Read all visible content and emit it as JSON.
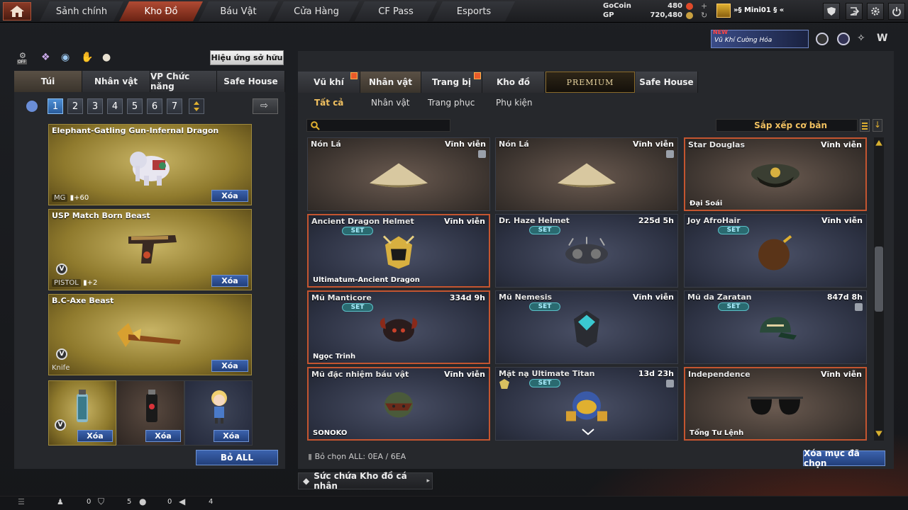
{
  "nav": {
    "tabs": [
      "Sảnh chính",
      "Kho Đồ",
      "Báu Vật",
      "Cửa Hàng",
      "CF Pass",
      "Esports"
    ],
    "active": 1
  },
  "currency": {
    "gocoin_label": "GoCoin",
    "gocoin_value": "480",
    "gp_label": "GP",
    "gp_value": "720,480"
  },
  "user": {
    "name": "»§ Mini01 § «"
  },
  "banner": {
    "new": "NEW",
    "text": "Vũ Khí Cường Hóa"
  },
  "left": {
    "effects_button": "Hiệu ứng sở hữu",
    "off_label": "OFF",
    "tabs": [
      "Túi",
      "Nhân vật",
      "VP Chức năng",
      "Safe House"
    ],
    "pages": [
      "1",
      "2",
      "3",
      "4",
      "5",
      "6",
      "7"
    ],
    "items": [
      {
        "name": "Elephant-Gatling Gun-Infernal Dragon",
        "tag": "MG",
        "bonus": "+60",
        "delete": "Xóa"
      },
      {
        "name": "USP Match Born Beast",
        "tag": "PISTOL",
        "bonus": "+2",
        "delete": "Xóa"
      },
      {
        "name": "B.C-Axe Beast",
        "tag": "Knife",
        "bonus": "",
        "delete": "Xóa"
      }
    ],
    "small_items": [
      {
        "delete": "Xóa"
      },
      {
        "delete": "Xóa"
      },
      {
        "delete": "Xóa"
      }
    ],
    "remove_all": "Bỏ ALL"
  },
  "right": {
    "tabs": [
      "Vũ khí",
      "Nhân vật",
      "Trang bị",
      "Kho đồ",
      "PREMIUM",
      "Safe House"
    ],
    "subtabs": [
      "Tất cả",
      "Nhân vật",
      "Trang phục",
      "Phụ kiện"
    ],
    "sort_label": "Sắp xếp cơ bản",
    "set_label": "SET",
    "cards": [
      {
        "name": "Nón Lá",
        "dur": "Vĩnh viễn",
        "sub": "",
        "set": false,
        "style": "brown",
        "hl": false,
        "lock": true
      },
      {
        "name": "Nón Lá",
        "dur": "Vĩnh viễn",
        "sub": "",
        "set": false,
        "style": "brown",
        "hl": false,
        "lock": true
      },
      {
        "name": "Star Douglas",
        "dur": "Vĩnh viễn",
        "sub": "Đại Soái",
        "set": false,
        "style": "brown",
        "hl": true,
        "lock": false
      },
      {
        "name": "Ancient Dragon Helmet",
        "dur": "Vĩnh viễn",
        "sub": "Ultimatum-Ancient Dragon",
        "set": true,
        "style": "blue",
        "hl": true,
        "lock": false
      },
      {
        "name": "Dr. Haze Helmet",
        "dur": "225d 5h",
        "sub": "",
        "set": true,
        "style": "blue",
        "hl": false,
        "lock": false
      },
      {
        "name": "Joy AfroHair",
        "dur": "Vĩnh viễn",
        "sub": "",
        "set": true,
        "style": "blue",
        "hl": false,
        "lock": false
      },
      {
        "name": "Mũ Manticore",
        "dur": "334d 9h",
        "sub": "Ngọc Trinh",
        "set": true,
        "style": "blue",
        "hl": true,
        "lock": false
      },
      {
        "name": "Mũ Nemesis",
        "dur": "Vĩnh viễn",
        "sub": "",
        "set": true,
        "style": "blue",
        "hl": false,
        "lock": false
      },
      {
        "name": "Mũ da Zaratan",
        "dur": "847d 8h",
        "sub": "",
        "set": true,
        "style": "blue",
        "hl": false,
        "lock": true
      },
      {
        "name": "Mũ đặc nhiệm báu vật",
        "dur": "Vĩnh viễn",
        "sub": "SONOKO",
        "set": false,
        "style": "blue",
        "hl": true,
        "lock": false
      },
      {
        "name": "Mặt nạ Ultimate Titan",
        "dur": "13d 23h",
        "sub": "",
        "set": true,
        "style": "blue",
        "hl": false,
        "lock": true
      },
      {
        "name": "Independence",
        "dur": "Vĩnh viễn",
        "sub": "Tổng Tư Lệnh",
        "set": false,
        "style": "brown",
        "hl": true,
        "lock": false
      }
    ],
    "deselect": "Bỏ chọn ALL: 0EA / 6EA",
    "delete_selected": "Xóa mục đã chọn",
    "capacity": "Sức chứa Kho đồ cá nhân"
  },
  "footer": {
    "counts": [
      "0",
      "5",
      "0",
      "4"
    ]
  }
}
